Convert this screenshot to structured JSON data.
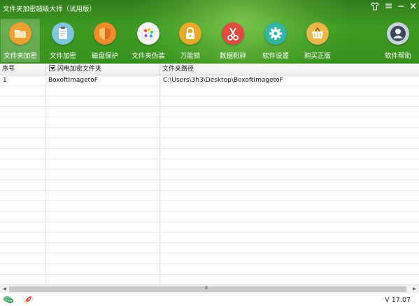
{
  "window": {
    "title": "文件夹加密超级大师（试用版）",
    "controls": [
      "shirt-icon",
      "menu-icon",
      "minimize-icon",
      "close-icon"
    ]
  },
  "toolbar": {
    "active_index": 0,
    "items": [
      {
        "label": "文件夹加密",
        "icon": "folder-icon",
        "color": "#f0a030"
      },
      {
        "label": "文件加密",
        "icon": "document-icon",
        "color": "#7fc8dc"
      },
      {
        "label": "磁盘保护",
        "icon": "shield-icon",
        "color": "#ef8c2a"
      },
      {
        "label": "文件夹伪装",
        "icon": "palette-icon",
        "color": "#f4f4f4"
      },
      {
        "label": "万能锁",
        "icon": "lock-icon",
        "color": "#e9a92a"
      },
      {
        "label": "数据粉碎",
        "icon": "scissors-icon",
        "color": "#e04b3f"
      },
      {
        "label": "软件设置",
        "icon": "gear-icon",
        "color": "#31b6a4"
      },
      {
        "label": "购买正版",
        "icon": "basket-icon",
        "color": "#e9b74a"
      },
      {
        "label": "软件帮助",
        "icon": "user-help-icon",
        "color": "#c9d4dc"
      }
    ]
  },
  "table": {
    "columns": [
      "序号",
      "闪电加密文件夹",
      "文件夹路径"
    ],
    "rows": [
      {
        "index": "1",
        "name": "BoxoftImagetoF",
        "path": "C:\\Users\\3h3\\Desktop\\BoxoftImagetoF"
      }
    ]
  },
  "scrollbar": {
    "grip": "III"
  },
  "status": {
    "icons": [
      "chat-icon",
      "rocket-icon"
    ],
    "version": "V 17.07"
  }
}
